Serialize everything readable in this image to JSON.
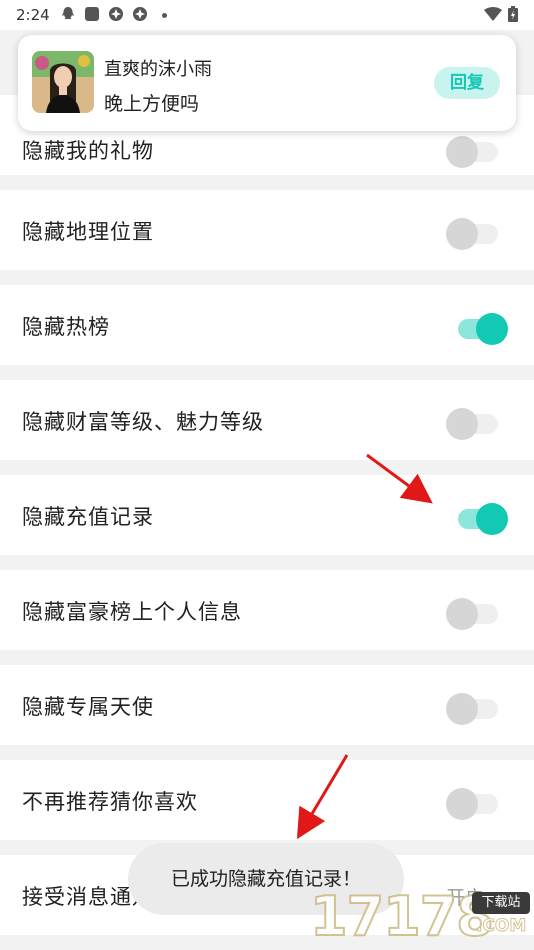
{
  "status_bar": {
    "time": "2:24",
    "icons": [
      "qq-icon",
      "app-icon",
      "aperture-icon",
      "aperture-icon",
      "dot-icon",
      "wifi-icon",
      "battery-charging-icon"
    ]
  },
  "notification": {
    "sender": "直爽的沫小雨",
    "message": "晚上方便吗",
    "reply_label": "回复"
  },
  "settings": [
    {
      "label": "隐藏我的礼物",
      "enabled": false
    },
    {
      "label": "隐藏地理位置",
      "enabled": false
    },
    {
      "label": "隐藏热榜",
      "enabled": true
    },
    {
      "label": "隐藏财富等级、魅力等级",
      "enabled": false
    },
    {
      "label": "隐藏充值记录",
      "enabled": true
    },
    {
      "label": "隐藏富豪榜上个人信息",
      "enabled": false
    },
    {
      "label": "隐藏专属天使",
      "enabled": false
    },
    {
      "label": "不再推荐猜你喜欢",
      "enabled": false
    },
    {
      "label": "接受消息通知",
      "enabled": false,
      "value_text": "开启"
    }
  ],
  "toast": {
    "text": "已成功隐藏充值记录！"
  },
  "watermark": {
    "digits": "17178",
    "badge": "下载站",
    "suffix": ".COM"
  },
  "colors": {
    "accent": "#12c9b4",
    "accent_light": "#8de6dc",
    "annotation": "#e01818"
  }
}
